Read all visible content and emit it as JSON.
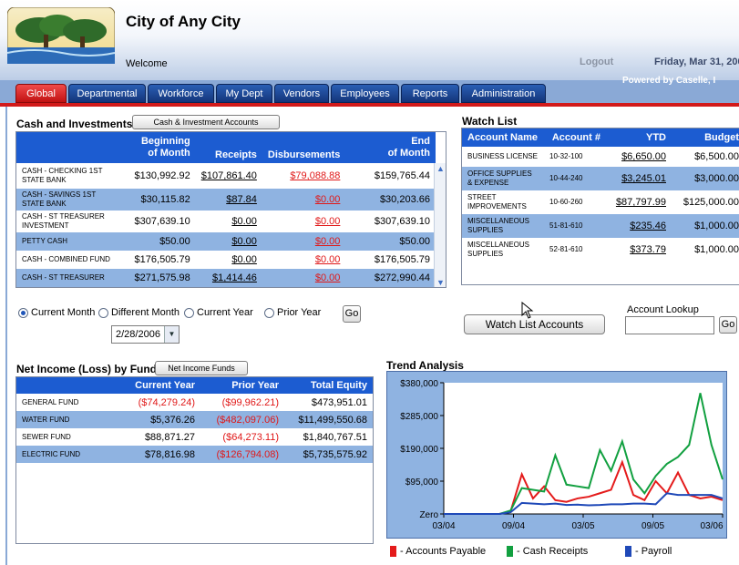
{
  "header": {
    "city_name": "City of Any City",
    "welcome": "Welcome",
    "logout": "Logout",
    "date": "Friday, Mar 31, 200",
    "powered": "Powered by Caselle, I"
  },
  "nav": {
    "tabs": [
      "Global",
      "Departmental",
      "Workforce",
      "My Dept",
      "Vendors",
      "Employees",
      "Reports",
      "Administration"
    ],
    "active": "Global"
  },
  "cash": {
    "title": "Cash and Investments",
    "button": "Cash & Investment Accounts",
    "headers": {
      "begin_1": "Beginning",
      "begin_2": "of Month",
      "receipts": "Receipts",
      "disb": "Disbursements",
      "end_1": "End",
      "end_2": "of Month"
    },
    "rows": [
      {
        "name": "CASH - CHECKING 1ST STATE BANK",
        "begin": "$130,992.92",
        "receipts": "$107,861.40",
        "disb": "$79,088.88",
        "end": "$159,765.44"
      },
      {
        "name": "CASH - SAVINGS 1ST STATE BANK",
        "begin": "$30,115.82",
        "receipts": "$87.84",
        "disb": "$0.00",
        "end": "$30,203.66"
      },
      {
        "name": "CASH - ST TREASURER INVESTMENT",
        "begin": "$307,639.10",
        "receipts": "$0.00",
        "disb": "$0.00",
        "end": "$307,639.10"
      },
      {
        "name": "PETTY CASH",
        "begin": "$50.00",
        "receipts": "$0.00",
        "disb": "$0.00",
        "end": "$50.00"
      },
      {
        "name": "CASH - COMBINED FUND",
        "begin": "$176,505.79",
        "receipts": "$0.00",
        "disb": "$0.00",
        "end": "$176,505.79"
      },
      {
        "name": "CASH - ST TREASURER",
        "begin": "$271,575.98",
        "receipts": "$1,414.46",
        "disb": "$0.00",
        "end": "$272,990.44"
      }
    ]
  },
  "period": {
    "options": [
      "Current Month",
      "Different Month",
      "Current Year",
      "Prior Year"
    ],
    "selected": "Current Month",
    "date_value": "2/28/2006",
    "go": "Go"
  },
  "watch": {
    "title": "Watch List",
    "headers": {
      "name": "Account Name",
      "acct": "Account #",
      "ytd": "YTD",
      "budget": "Budget"
    },
    "rows": [
      {
        "name": "BUSINESS LICENSE",
        "acct": "10-32-100",
        "ytd": "$6,650.00",
        "budget": "$6,500.00"
      },
      {
        "name": "OFFICE SUPPLIES & EXPENSE",
        "acct": "10-44-240",
        "ytd": "$3,245.01",
        "budget": "$3,000.00"
      },
      {
        "name": "STREET IMPROVEMENTS",
        "acct": "10-60-260",
        "ytd": "$87,797.99",
        "budget": "$125,000.00"
      },
      {
        "name": "MISCELLANEOUS SUPPLIES",
        "acct": "51-81-610",
        "ytd": "$235.46",
        "budget": "$1,000.00"
      },
      {
        "name": "MISCELLANEOUS SUPPLIES",
        "acct": "52-81-610",
        "ytd": "$373.79",
        "budget": "$1,000.00"
      }
    ],
    "button": "Watch List Accounts",
    "lookup_label": "Account Lookup",
    "lookup_go": "Go"
  },
  "net": {
    "title": "Net Income (Loss) by Fund",
    "button": "Net Income Funds",
    "headers": {
      "current": "Current Year",
      "prior": "Prior Year",
      "equity": "Total Equity"
    },
    "rows": [
      {
        "name": "GENERAL FUND",
        "current": "($74,279.24)",
        "prior": "($99,962.21)",
        "equity": "$473,951.01"
      },
      {
        "name": "WATER FUND",
        "current": "$5,376.26",
        "prior": "($482,097.06)",
        "equity": "$11,499,550.68"
      },
      {
        "name": "SEWER FUND",
        "current": "$88,871.27",
        "prior": "($64,273.11)",
        "equity": "$1,840,767.51"
      },
      {
        "name": "ELECTRIC FUND",
        "current": "$78,816.98",
        "prior": "($126,794.08)",
        "equity": "$5,735,575.92"
      }
    ]
  },
  "colors": {
    "header_blue": "#1c5cd1",
    "row_alt": "#8fb3e1",
    "tab_active": "#d21a1a",
    "negative": "#e01818"
  },
  "chart_data": {
    "type": "line",
    "title": "Trend Analysis",
    "x_ticks": [
      "03/04",
      "09/04",
      "03/05",
      "09/05",
      "03/06"
    ],
    "y_ticks": [
      "Zero",
      "$95,000",
      "$190,000",
      "$285,000",
      "$380,000"
    ],
    "ylim": [
      0,
      380000
    ],
    "x": [
      0,
      1,
      2,
      3,
      4,
      5,
      6,
      7,
      8,
      9,
      10,
      11,
      12,
      13,
      14,
      15,
      16,
      17,
      18,
      19,
      20,
      21,
      22,
      23,
      24,
      25
    ],
    "series": [
      {
        "name": "- Accounts Payable",
        "color": "#e41b1b",
        "values": [
          0,
          0,
          0,
          0,
          0,
          0,
          8000,
          115000,
          45000,
          80000,
          40000,
          35000,
          45000,
          50000,
          60000,
          70000,
          150000,
          55000,
          40000,
          95000,
          60000,
          120000,
          55000,
          45000,
          50000,
          40000
        ]
      },
      {
        "name": "- Cash Receipts",
        "color": "#12a040",
        "values": [
          0,
          0,
          0,
          0,
          0,
          0,
          10000,
          75000,
          70000,
          65000,
          170000,
          85000,
          80000,
          75000,
          185000,
          125000,
          210000,
          100000,
          60000,
          110000,
          145000,
          165000,
          200000,
          350000,
          200000,
          100000
        ]
      },
      {
        "name": "- Payroll",
        "color": "#1f49b8",
        "values": [
          0,
          0,
          0,
          0,
          0,
          0,
          5000,
          32000,
          30000,
          28000,
          30000,
          26000,
          27000,
          25000,
          26000,
          28000,
          28000,
          30000,
          30000,
          28000,
          60000,
          55000,
          55000,
          55000,
          55000,
          45000
        ]
      }
    ]
  }
}
